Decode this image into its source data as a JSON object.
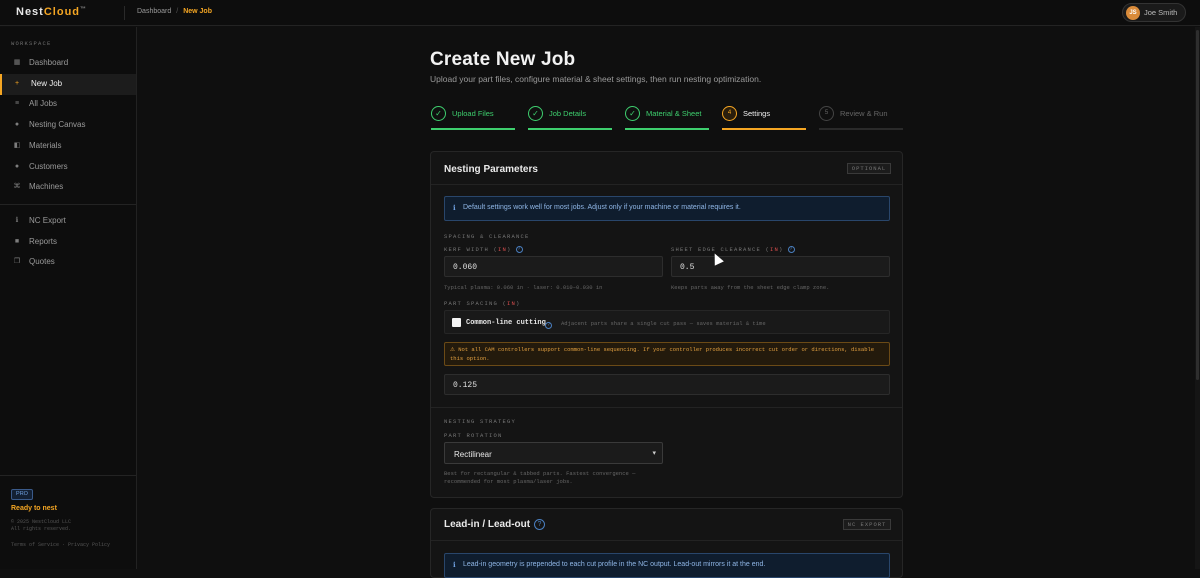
{
  "header": {
    "logo_a": "Nest",
    "logo_b": "Cloud",
    "logo_tm": "™",
    "breadcrumb": [
      "Dashboard",
      "New Job"
    ],
    "breadcrumb_sep": "/",
    "user": {
      "initials": "JS",
      "name": "Joe Smith"
    }
  },
  "sidebar": {
    "section_label": "WORKSPACE",
    "items": [
      {
        "label": "Dashboard",
        "icon": "grid-icon",
        "glyph": "▦"
      },
      {
        "label": "New Job",
        "icon": "plus-icon",
        "glyph": "+",
        "active": true
      },
      {
        "label": "All Jobs",
        "icon": "list-icon",
        "glyph": "≡"
      },
      {
        "label": "Nesting Canvas",
        "icon": "canvas-icon",
        "glyph": "●"
      },
      {
        "label": "Materials",
        "icon": "layers-icon",
        "glyph": "◧"
      },
      {
        "label": "Customers",
        "icon": "customers-icon",
        "glyph": "●"
      },
      {
        "label": "Machines",
        "icon": "machine-icon",
        "glyph": "⌘"
      }
    ],
    "items2": [
      {
        "label": "NC Export",
        "icon": "export-icon",
        "glyph": "ℹ"
      },
      {
        "label": "Reports",
        "icon": "reports-icon",
        "glyph": "■"
      },
      {
        "label": "Quotes",
        "icon": "quotes-icon",
        "glyph": "❐"
      }
    ],
    "footer": {
      "badge": "PRO",
      "status": "Ready to nest",
      "copyright_1": "© 2025 NestCloud LLC",
      "copyright_2": "All rights reserved.",
      "terms": "Terms of Service · Privacy Policy"
    }
  },
  "page": {
    "title": "Create New Job",
    "subtitle": "Upload your part files, configure material & sheet settings, then run nesting optimization."
  },
  "steps": [
    {
      "label": "Upload Files",
      "mark": "✓",
      "state": "done"
    },
    {
      "label": "Job Details",
      "mark": "✓",
      "state": "done"
    },
    {
      "label": "Material & Sheet",
      "mark": "✓",
      "state": "done"
    },
    {
      "label": "Settings",
      "mark": "4",
      "state": "current"
    },
    {
      "label": "Review & Run",
      "mark": "5",
      "state": "future"
    }
  ],
  "nesting": {
    "title": "Nesting Parameters",
    "tag": "OPTIONAL",
    "info": "Default settings work well for most jobs. Adjust only if your machine or material requires it.",
    "spacing_heading": "SPACING & CLEARANCE",
    "kerf_label": "KERF WIDTH (",
    "kerf_unit": "IN",
    "kerf_close": ")",
    "kerf_value": "0.060",
    "kerf_hint": "Typical plasma: 0.060 in · laser: 0.010–0.030 in",
    "edge_label": "SHEET EDGE CLEARANCE (",
    "edge_unit": "IN",
    "edge_close": ")",
    "edge_value": "0.5",
    "edge_hint": "Keeps parts away from the sheet edge clamp zone.",
    "part_spacing_label": "PART SPACING (",
    "part_spacing_unit": "IN",
    "part_spacing_close": ")",
    "common_line_label": "Common-line cutting",
    "common_line_hint": "Adjacent parts share a single cut pass — saves material & time",
    "warning": "⚠ Not all CAM controllers support common-line sequencing. If your controller produces incorrect cut order or directions, disable this option.",
    "part_spacing_value": "0.125",
    "strategy_heading": "NESTING STRATEGY",
    "rotation_label": "PART ROTATION",
    "rotation_value": "Rectilinear",
    "rotation_hint_1": "Best for rectangular & tabbed parts. Fastest convergence —",
    "rotation_hint_2": "recommended for most plasma/laser jobs."
  },
  "leadin": {
    "title": "Lead-in / Lead-out",
    "tag": "NC EXPORT",
    "info": "Lead-in geometry is prepended to each cut profile in the NC output. Lead-out mirrors it at the end."
  },
  "colors": {
    "accent": "#f5a623",
    "success": "#3ecf6e",
    "info": "#6fa0e0",
    "warn": "#e2a040"
  }
}
